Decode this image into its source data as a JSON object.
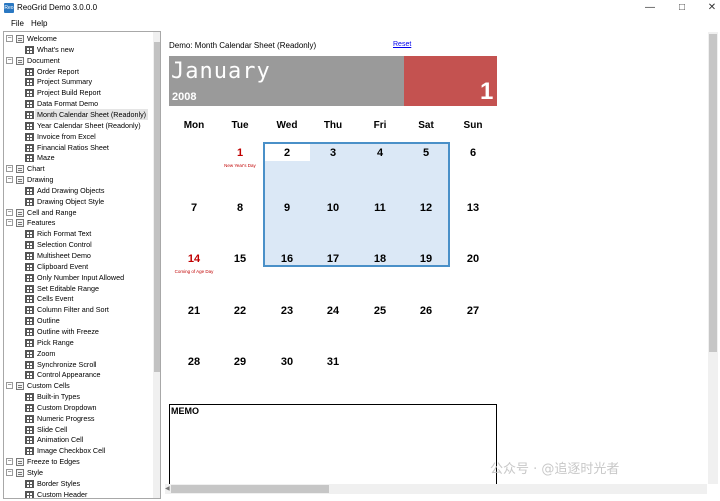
{
  "window": {
    "title": "ReoGrid Demo 3.0.0.0",
    "icon_text": "Reo"
  },
  "menu": {
    "file": "File",
    "help": "Help"
  },
  "tree": [
    {
      "label": "Welcome",
      "type": "folder",
      "level": 0
    },
    {
      "label": "What's new",
      "type": "item",
      "level": 1
    },
    {
      "label": "Document",
      "type": "folder",
      "level": 0
    },
    {
      "label": "Order Report",
      "type": "item",
      "level": 1
    },
    {
      "label": "Project Summary",
      "type": "item",
      "level": 1
    },
    {
      "label": "Project Build Report",
      "type": "item",
      "level": 1
    },
    {
      "label": "Data Format Demo",
      "type": "item",
      "level": 1
    },
    {
      "label": "Month Calendar Sheet (Readonly)",
      "type": "item",
      "level": 1,
      "selected": true
    },
    {
      "label": "Year Calendar Sheet (Readonly)",
      "type": "item",
      "level": 1
    },
    {
      "label": "Invoice from Excel",
      "type": "item",
      "level": 1
    },
    {
      "label": "Financial Ratios Sheet",
      "type": "item",
      "level": 1
    },
    {
      "label": "Maze",
      "type": "item",
      "level": 1
    },
    {
      "label": "Chart",
      "type": "folder",
      "level": 0
    },
    {
      "label": "Drawing",
      "type": "folder",
      "level": 0
    },
    {
      "label": "Add Drawing Objects",
      "type": "item",
      "level": 1
    },
    {
      "label": "Drawing Object Style",
      "type": "item",
      "level": 1
    },
    {
      "label": "Cell and Range",
      "type": "folder",
      "level": 0
    },
    {
      "label": "Features",
      "type": "folder",
      "level": 0
    },
    {
      "label": "Rich Format Text",
      "type": "item",
      "level": 1
    },
    {
      "label": "Selection Control",
      "type": "item",
      "level": 1
    },
    {
      "label": "Multisheet Demo",
      "type": "item",
      "level": 1
    },
    {
      "label": "Clipboard Event",
      "type": "item",
      "level": 1
    },
    {
      "label": "Only Number Input Allowed",
      "type": "item",
      "level": 1
    },
    {
      "label": "Set Editable Range",
      "type": "item",
      "level": 1
    },
    {
      "label": "Cells Event",
      "type": "item",
      "level": 1
    },
    {
      "label": "Column Filter and Sort",
      "type": "item",
      "level": 1
    },
    {
      "label": "Outline",
      "type": "item",
      "level": 1
    },
    {
      "label": "Outline with Freeze",
      "type": "item",
      "level": 1
    },
    {
      "label": "Pick Range",
      "type": "item",
      "level": 1
    },
    {
      "label": "Zoom",
      "type": "item",
      "level": 1
    },
    {
      "label": "Synchronize Scroll",
      "type": "item",
      "level": 1
    },
    {
      "label": "Control Appearance",
      "type": "item",
      "level": 1
    },
    {
      "label": "Custom Cells",
      "type": "folder",
      "level": 0
    },
    {
      "label": "Built-in Types",
      "type": "item",
      "level": 1
    },
    {
      "label": "Custom Dropdown",
      "type": "item",
      "level": 1
    },
    {
      "label": "Numeric Progress",
      "type": "item",
      "level": 1
    },
    {
      "label": "Slide Cell",
      "type": "item",
      "level": 1
    },
    {
      "label": "Animation Cell",
      "type": "item",
      "level": 1
    },
    {
      "label": "Image Checkbox Cell",
      "type": "item",
      "level": 1
    },
    {
      "label": "Freeze to Edges",
      "type": "folder",
      "level": 0
    },
    {
      "label": "Style",
      "type": "folder",
      "level": 0
    },
    {
      "label": "Border Styles",
      "type": "item",
      "level": 1
    },
    {
      "label": "Custom Header",
      "type": "item",
      "level": 1
    }
  ],
  "demo": {
    "title": "Demo: Month Calendar Sheet (Readonly)",
    "reset_label": "Reset"
  },
  "calendar": {
    "month": "January",
    "year": "2008",
    "day": "1",
    "weekdays": [
      "Mon",
      "Tue",
      "Wed",
      "Thu",
      "Fri",
      "Sat",
      "Sun"
    ],
    "weeks": [
      [
        "",
        "1",
        "2",
        "3",
        "4",
        "5",
        "6"
      ],
      [
        "7",
        "8",
        "9",
        "10",
        "11",
        "12",
        "13"
      ],
      [
        "14",
        "15",
        "16",
        "17",
        "18",
        "19",
        "20"
      ],
      [
        "21",
        "22",
        "23",
        "24",
        "25",
        "26",
        "27"
      ],
      [
        "28",
        "29",
        "30",
        "31",
        "",
        "",
        ""
      ]
    ],
    "holidays": [
      {
        "week": 0,
        "day": 1,
        "note": "New Year's Day"
      },
      {
        "week": 2,
        "day": 0,
        "note": "Coming of Age Day"
      }
    ],
    "colors": {
      "header_gray": "#9a9a9a",
      "header_red": "#c45250",
      "holiday": "#c00000",
      "selection": "#dbe8f6",
      "selection_border": "#4a90c8"
    }
  },
  "memo": {
    "title": "MEMO"
  },
  "watermark": "公众号 · @追逐时光者"
}
